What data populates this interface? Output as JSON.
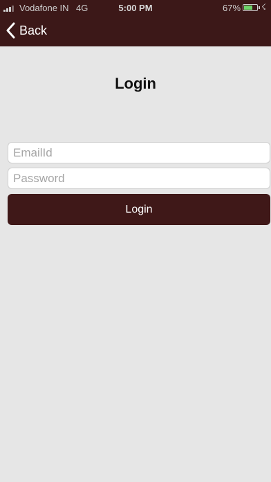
{
  "status_bar": {
    "carrier": "Vodafone IN",
    "network": "4G",
    "time": "5:00 PM",
    "battery_percent": "67%",
    "battery_level": 0.67,
    "signal_icon": "signal-bars-icon",
    "battery_icon": "battery-icon",
    "charging_icon": "charging-bolt-icon"
  },
  "nav": {
    "back_label": "Back",
    "back_icon": "chevron-left-icon"
  },
  "page": {
    "title": "Login"
  },
  "form": {
    "email_placeholder": "EmailId",
    "email_value": "",
    "password_placeholder": "Password",
    "password_value": "",
    "submit_label": "Login"
  },
  "colors": {
    "header_bg": "#3c1818",
    "button_bg": "#3f1818",
    "page_bg": "#e6e6e6",
    "battery_fill": "#6fd36a"
  }
}
